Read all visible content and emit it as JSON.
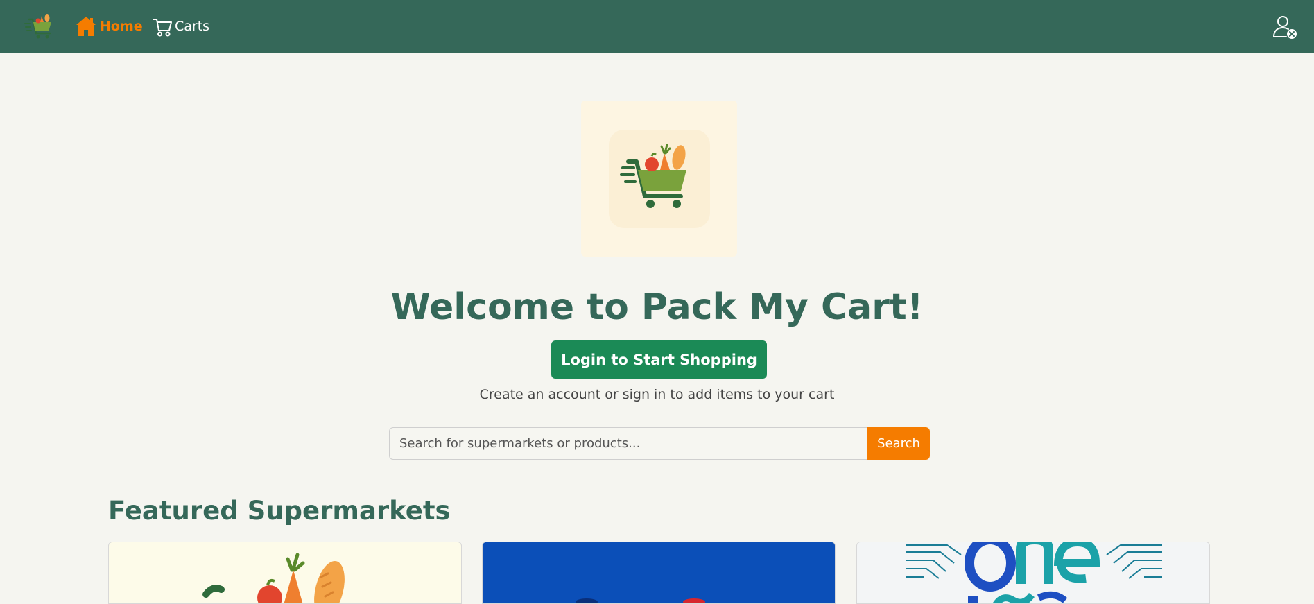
{
  "navbar": {
    "brand_icon": "shopping-cart-logo-icon",
    "home_label": "Home",
    "home_icon": "house-icon",
    "carts_label": "Carts",
    "carts_icon": "cart-icon",
    "user_icon": "user-logged-out-icon",
    "background_color": "#356859",
    "active_color": "#f57c00"
  },
  "hero": {
    "logo_icon": "shopping-cart-logo-icon",
    "title": "Welcome to Pack My Cart!",
    "login_button_label": "Login to Start Shopping",
    "subtitle": "Create an account or sign in to add items to your cart",
    "title_color": "#356859",
    "button_color": "#1b8a56"
  },
  "search": {
    "placeholder": "Search for supermarkets or products...",
    "value": "",
    "button_label": "Search",
    "button_color": "#f57c00"
  },
  "featured": {
    "title": "Featured Supermarkets",
    "cards": [
      {
        "image_icon": "grocery-logo-image"
      },
      {
        "image_icon": "blue-brand-logo-image"
      },
      {
        "image_icon": "one-love-logo-image"
      }
    ]
  }
}
